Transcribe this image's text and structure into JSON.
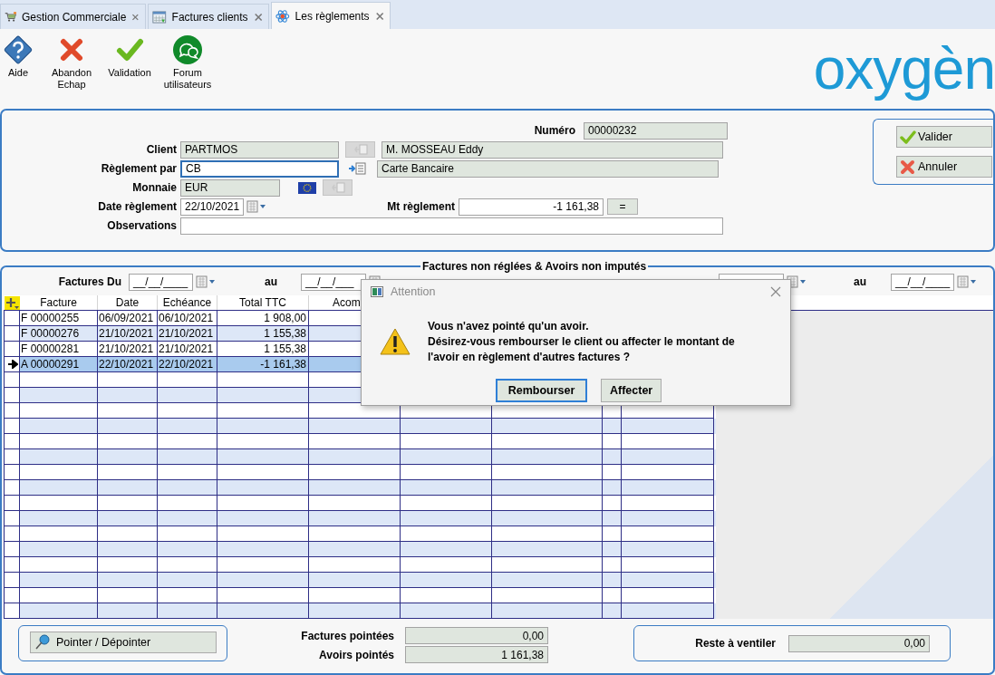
{
  "tabs": [
    {
      "label": "Gestion Commerciale",
      "selected": false
    },
    {
      "label": "Factures clients",
      "selected": false
    },
    {
      "label": "Les règlements",
      "selected": true
    }
  ],
  "toolbar": [
    {
      "label": "Aide"
    },
    {
      "label": "Abandon\nEchap"
    },
    {
      "label": "Validation"
    },
    {
      "label": "Forum\nutilisateurs"
    }
  ],
  "logo": "oxygèn",
  "form": {
    "numero": {
      "label": "Numéro",
      "value": "00000232"
    },
    "client": {
      "label": "Client",
      "code": "PARTMOS",
      "name": "M. MOSSEAU Eddy"
    },
    "reglement_par": {
      "label": "Règlement par",
      "code": "CB",
      "name": "Carte Bancaire",
      "focused": true
    },
    "monnaie": {
      "label": "Monnaie",
      "code": "EUR"
    },
    "date_reglement": {
      "label": "Date règlement",
      "value": "22/10/2021"
    },
    "mt_reglement": {
      "label": "Mt règlement",
      "value": "-1 161,38",
      "button": "="
    },
    "observations": {
      "label": "Observations"
    }
  },
  "side_buttons": [
    "Valider",
    "Annuler"
  ],
  "section": {
    "title": "Factures non réglées & Avoirs non imputés",
    "filters": {
      "label": "Factures Du",
      "from": "__/__/____",
      "to_label": "au",
      "to": "__/__/___",
      "to_label_2": "au",
      "to_2": "__/__/____"
    },
    "table": {
      "columns": [
        "Facture",
        "Date",
        "Echéance",
        "Total TTC",
        "Acom"
      ],
      "rows": [
        {
          "cells": [
            "F 00000255",
            "06/09/2021",
            "06/10/2021",
            "1 908,00"
          ],
          "selected": false
        },
        {
          "cells": [
            "F 00000276",
            "21/10/2021",
            "21/10/2021",
            "1 155,38"
          ],
          "selected": false
        },
        {
          "cells": [
            "F 00000281",
            "21/10/2021",
            "21/10/2021",
            "1 155,38"
          ],
          "selected": false
        },
        {
          "cells": [
            "A 00000291",
            "22/10/2021",
            "22/10/2021",
            "-1 161,38"
          ],
          "selected": true
        }
      ]
    },
    "pointer_button": "Pointer / Dépointer",
    "totals": [
      {
        "label": "Factures pointées",
        "value": "0,00"
      },
      {
        "label": "Avoirs pointés",
        "value": "1 161,38"
      }
    ],
    "reste": {
      "label": "Reste à ventiler",
      "value": "0,00"
    }
  },
  "dialog": {
    "title": "Attention",
    "message": [
      "Vous n'avez pointé qu'un avoir.",
      "Désirez-vous rembourser le client ou affecter le montant de l'avoir en règlement d'autres factures ?"
    ],
    "buttons": [
      {
        "label": "Rembourser",
        "selected": true
      },
      {
        "label": "Affecter",
        "selected": false
      }
    ]
  }
}
